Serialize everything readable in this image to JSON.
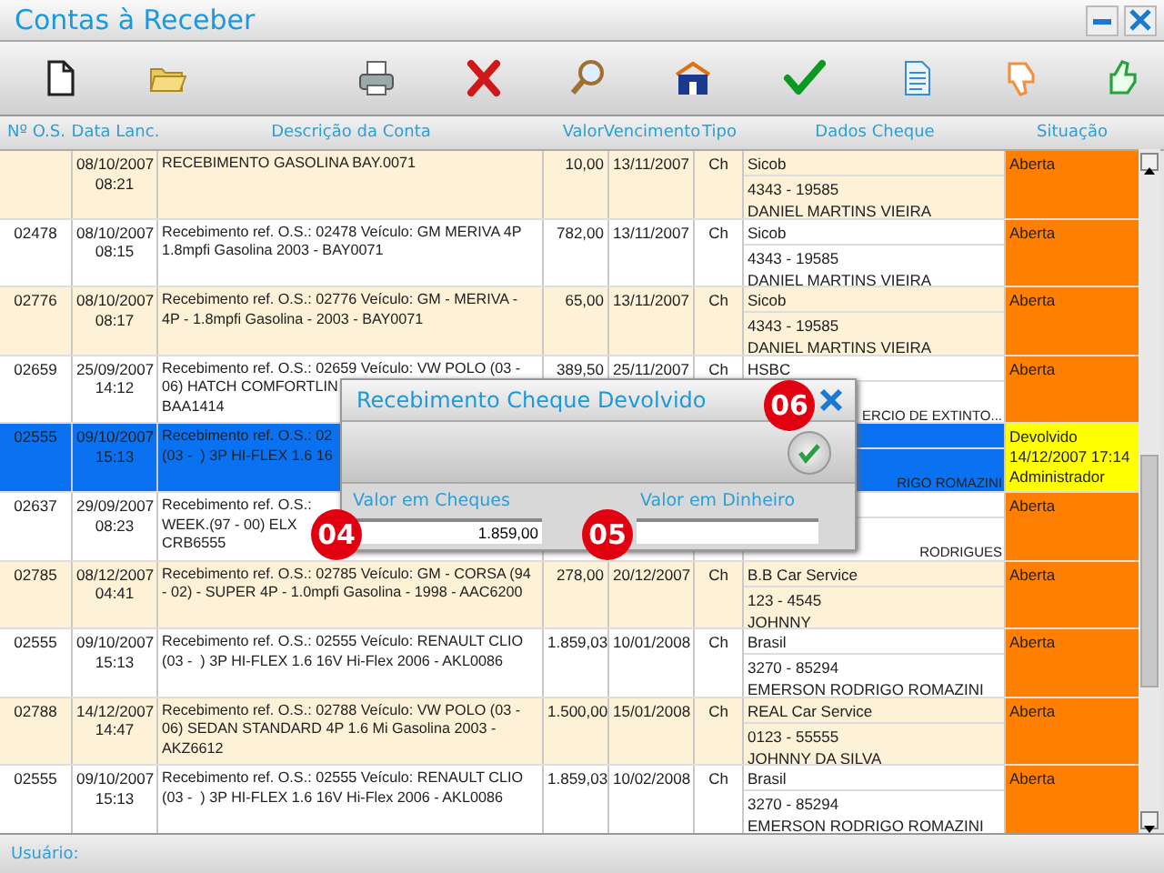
{
  "window": {
    "title": "Contas à Receber"
  },
  "columns": [
    "Nº O.S.",
    "Data Lanc.",
    "Descrição da Conta",
    "Valor",
    "Vencimento",
    "Tipo",
    "Dados Cheque",
    "Situação"
  ],
  "rows": [
    {
      "date": "08/10/2007",
      "time": "08:21",
      "description": "RECEBIMENTO GASOLINA BAY.0071",
      "value": "10,00",
      "due": "13/11/2007",
      "type": "Ch",
      "bank": "Sicob",
      "account": "4343 - 19585",
      "holder": "DANIEL MARTINS VIEIRA",
      "status": "Aberta",
      "color": "#ff8000",
      "selected": false
    },
    {
      "os": "02478",
      "date": "08/10/2007",
      "time": "08:15",
      "description": "Recebimento ref. O.S.: 02478 Veículo: GM MERIVA 4P\n1.8mpfi Gasolina 2003 - BAY0071",
      "value": "782,00",
      "due": "13/11/2007",
      "type": "Ch",
      "bank": "Sicob",
      "account": "4343 - 19585",
      "holder": "DANIEL MARTINS VIEIRA",
      "status": "Aberta",
      "color": "#ff8000",
      "selected": false
    },
    {
      "os": "02776",
      "date": "08/10/2007",
      "time": "08:17",
      "description": "Recebimento ref. O.S.: 02776 Veículo: GM - MERIVA -\n4P - 1.8mpfi Gasolina - 2003 - BAY0071",
      "value": "65,00",
      "due": "13/11/2007",
      "type": "Ch",
      "bank": "Sicob",
      "account": "4343 - 19585",
      "holder": "DANIEL MARTINS VIEIRA",
      "status": "Aberta",
      "color": "#ff8000",
      "selected": false
    },
    {
      "os": "02659",
      "date": "25/09/2007",
      "time": "14:12",
      "description": "Recebimento ref. O.S.: 02659 Veículo: VW POLO (03 -\n06) HATCH COMFORTLIN\nBAA1414",
      "value": "389,50",
      "due": "25/11/2007",
      "type": "Ch",
      "bank": "HSBC",
      "holder": "ERCIO DE EXTINTO...",
      "status": "Aberta",
      "color": "#ff8000",
      "selected": false,
      "covered": true
    },
    {
      "os": "02555",
      "date": "09/10/2007",
      "time": "15:13",
      "description": "Recebimento ref. O.S.: 02\n(03 -  ) 3P HI-FLEX 1.6 16",
      "holder": "RIGO ROMAZINI",
      "status": "Devolvido\n14/12/2007 17:14\nAdministrador",
      "color": "#ffff00",
      "selected": true,
      "covered": true
    },
    {
      "os": "02637",
      "date": "29/09/2007",
      "time": "08:23",
      "description": "Recebimento ref. O.S.:\nWEEK.(97 - 00) ELX\nCRB6555",
      "holder": "RODRIGUES",
      "status": "Aberta",
      "color": "#ff8000",
      "selected": false,
      "covered": true
    },
    {
      "os": "02785",
      "date": "08/12/2007",
      "time": "04:41",
      "description": "Recebimento ref. O.S.: 02785 Veículo: GM - CORSA (94\n- 02) - SUPER 4P - 1.0mpfi Gasolina - 1998 - AAC6200",
      "value": "278,00",
      "due": "20/12/2007",
      "type": "Ch",
      "bank": "B.B Car Service",
      "account": "123 - 4545",
      "holder": "JOHNNY",
      "status": "Aberta",
      "color": "#ff8000",
      "selected": false
    },
    {
      "os": "02555",
      "date": "09/10/2007",
      "time": "15:13",
      "description": "Recebimento ref. O.S.: 02555 Veículo: RENAULT CLIO\n(03 -  ) 3P HI-FLEX 1.6 16V Hi-Flex 2006 - AKL0086",
      "value": "1.859,03",
      "due": "10/01/2008",
      "type": "Ch",
      "bank": "Brasil",
      "account": "3270 - 85294",
      "holder": "EMERSON RODRIGO ROMAZINI",
      "status": "Aberta",
      "color": "#ff8000",
      "selected": false
    },
    {
      "os": "02788",
      "date": "14/12/2007",
      "time": "14:47",
      "description": "Recebimento ref. O.S.: 02788 Veículo: VW POLO (03 -\n06) SEDAN STANDARD 4P 1.6 Mi Gasolina 2003 -\nAKZ6612",
      "value": "1.500,00",
      "due": "15/01/2008",
      "type": "Ch",
      "bank": "REAL Car Service",
      "account": "0123 - 55555",
      "holder": "JOHNNY DA SILVA",
      "status": "Aberta",
      "color": "#ff8000",
      "selected": false
    },
    {
      "os": "02555",
      "date": "09/10/2007",
      "time": "15:13",
      "description": "Recebimento ref. O.S.: 02555 Veículo: RENAULT CLIO\n(03 -  ) 3P HI-FLEX 1.6 16V Hi-Flex 2006 - AKL0086",
      "value": "1.859,03",
      "due": "10/02/2008",
      "type": "Ch",
      "bank": "Brasil",
      "account": "3270 - 85294",
      "holder": "EMERSON RODRIGO ROMAZINI",
      "status": "Aberta",
      "color": "#ff8000",
      "selected": false
    }
  ],
  "dialog": {
    "title": "Recebimento Cheque Devolvido",
    "cheques_label": "Valor em Cheques",
    "cheques_value": "1.859,00",
    "cash_label": "Valor em Dinheiro"
  },
  "callouts": [
    {
      "kind": "close",
      "label": "06"
    },
    {
      "kind": "cheques",
      "label": "04"
    },
    {
      "kind": "cash",
      "label": "05"
    }
  ],
  "status_bar": {
    "label": "Usuário:"
  }
}
